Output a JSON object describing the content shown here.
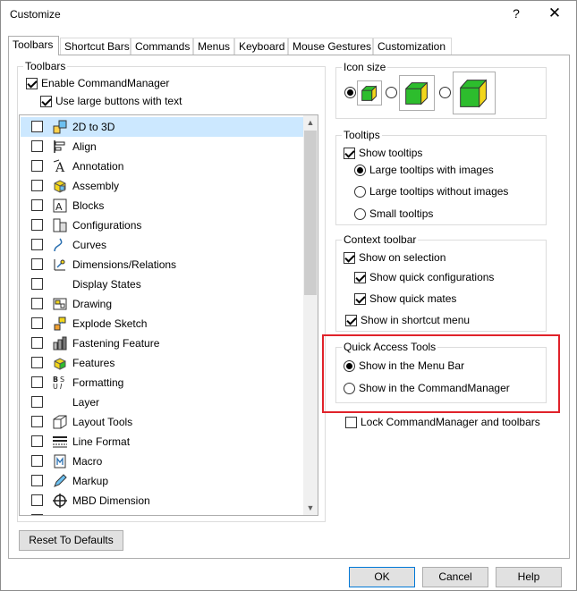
{
  "window": {
    "title": "Customize",
    "help_glyph": "?",
    "close_glyph": "✕"
  },
  "tabs": [
    {
      "label": "Toolbars",
      "active": true
    },
    {
      "label": "Shortcut Bars",
      "active": false
    },
    {
      "label": "Commands",
      "active": false
    },
    {
      "label": "Menus",
      "active": false
    },
    {
      "label": "Keyboard",
      "active": false
    },
    {
      "label": "Mouse Gestures",
      "active": false
    },
    {
      "label": "Customization",
      "active": false
    }
  ],
  "toolbars_group": {
    "label": "Toolbars",
    "enable_commandmanager": {
      "label": "Enable CommandManager",
      "checked": true
    },
    "use_large_buttons": {
      "label": "Use large buttons with text",
      "checked": true
    },
    "items": [
      {
        "label": "2D to 3D",
        "icon": "2d-to-3d-icon",
        "checked": false,
        "selected": true
      },
      {
        "label": "Align",
        "icon": "align-icon",
        "checked": false
      },
      {
        "label": "Annotation",
        "icon": "annotation-icon",
        "checked": false
      },
      {
        "label": "Assembly",
        "icon": "assembly-icon",
        "checked": false
      },
      {
        "label": "Blocks",
        "icon": "blocks-icon",
        "checked": false
      },
      {
        "label": "Configurations",
        "icon": "configurations-icon",
        "checked": false
      },
      {
        "label": "Curves",
        "icon": "curves-icon",
        "checked": false
      },
      {
        "label": "Dimensions/Relations",
        "icon": "dimensions-icon",
        "checked": false
      },
      {
        "label": "Display States",
        "icon": "",
        "checked": false
      },
      {
        "label": "Drawing",
        "icon": "drawing-icon",
        "checked": false
      },
      {
        "label": "Explode Sketch",
        "icon": "explode-sketch-icon",
        "checked": false
      },
      {
        "label": "Fastening Feature",
        "icon": "fastening-feature-icon",
        "checked": false
      },
      {
        "label": "Features",
        "icon": "features-icon",
        "checked": false
      },
      {
        "label": "Formatting",
        "icon": "formatting-icon",
        "checked": false
      },
      {
        "label": "Layer",
        "icon": "",
        "checked": false
      },
      {
        "label": "Layout Tools",
        "icon": "layout-tools-icon",
        "checked": false
      },
      {
        "label": "Line Format",
        "icon": "line-format-icon",
        "checked": false
      },
      {
        "label": "Macro",
        "icon": "macro-icon",
        "checked": false
      },
      {
        "label": "Markup",
        "icon": "markup-icon",
        "checked": false
      },
      {
        "label": "MBD Dimension",
        "icon": "mbd-dimension-icon",
        "checked": false
      }
    ]
  },
  "icon_size": {
    "label": "Icon size",
    "options": [
      {
        "size": "small",
        "selected": true
      },
      {
        "size": "medium",
        "selected": false
      },
      {
        "size": "large",
        "selected": false
      }
    ]
  },
  "tooltips": {
    "label": "Tooltips",
    "show_tooltips": {
      "label": "Show tooltips",
      "checked": true
    },
    "options": [
      {
        "label": "Large tooltips with images",
        "selected": true
      },
      {
        "label": "Large tooltips without images",
        "selected": false
      },
      {
        "label": "Small tooltips",
        "selected": false
      }
    ]
  },
  "context_toolbar": {
    "label": "Context toolbar",
    "show_on_selection": {
      "label": "Show on selection",
      "checked": true
    },
    "show_quick_configurations": {
      "label": "Show quick configurations",
      "checked": true
    },
    "show_quick_mates": {
      "label": "Show quick mates",
      "checked": true
    },
    "show_in_shortcut_menu": {
      "label": "Show in shortcut menu",
      "checked": true
    }
  },
  "quick_access_tools": {
    "label": "Quick Access Tools",
    "options": [
      {
        "label": "Show in the Menu Bar",
        "selected": true
      },
      {
        "label": "Show in the CommandManager",
        "selected": false
      }
    ],
    "highlight_color": "#e0222a"
  },
  "lock_commandmanager": {
    "label": "Lock CommandManager and toolbars",
    "checked": false
  },
  "buttons": {
    "reset": "Reset To Defaults",
    "ok": "OK",
    "cancel": "Cancel",
    "help": "Help"
  },
  "colors": {
    "selection": "#cce8ff",
    "default_button_border": "#0078d7",
    "cube_green": "#2dbd2d",
    "cube_yellow": "#f2d61c"
  }
}
